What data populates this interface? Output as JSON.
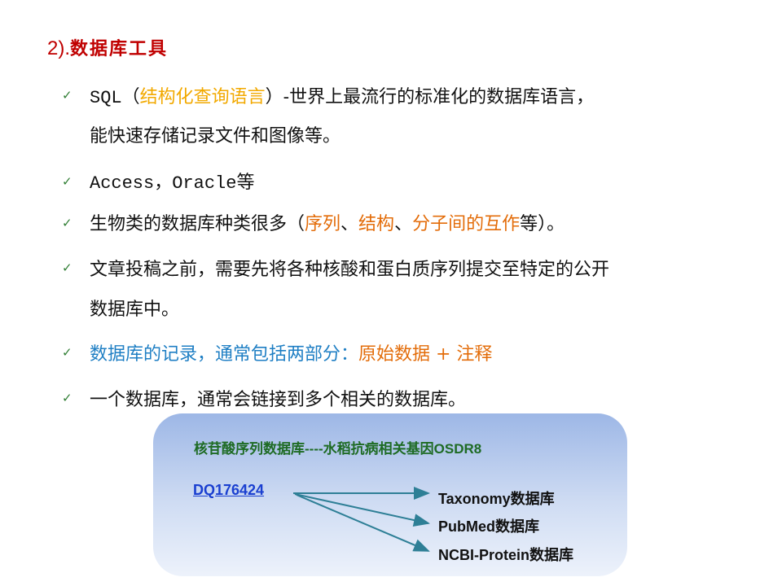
{
  "heading": {
    "number": "2).",
    "text": "数据库工具"
  },
  "bullet_glyph": "✓",
  "bullets": [
    {
      "parts": [
        "SQL",
        "（",
        "结构化查询语言",
        "）-世界上最流行的标准化的数据库语言，"
      ],
      "continuation": "能快速存储记录文件和图像等。"
    },
    {
      "parts": [
        "Access，Oracle",
        "等"
      ]
    },
    {
      "parts": [
        "生物类的数据库种类很多（",
        "序列",
        "、",
        "结构",
        "、",
        "分子间的互作",
        "等）。"
      ]
    },
    {
      "text": "文章投稿之前，需要先将各种核酸和蛋白质序列提交至特定的公开",
      "continuation": "数据库中。"
    },
    {
      "parts": [
        "数据库的记录，通常包括两部分：",
        "原始数据 + 注释"
      ]
    },
    {
      "text": "一个数据库，通常会链接到多个相关的数据库。"
    }
  ],
  "panel": {
    "title": "核苷酸序列数据库----水稻抗病相关基因OSDR8",
    "accession": "DQ176424",
    "targets": [
      "Taxonomy数据库",
      "PubMed数据库",
      "NCBI-Protein数据库"
    ]
  },
  "colors": {
    "heading": "#c00000",
    "highlight_yellow": "#f2a900",
    "highlight_orange": "#e36c09",
    "highlight_blue": "#1f7fc4",
    "bullet_check": "#2e7d32",
    "panel_title": "#1e6b24",
    "link": "#1a3fd0",
    "arrow": "#2e7f96"
  }
}
